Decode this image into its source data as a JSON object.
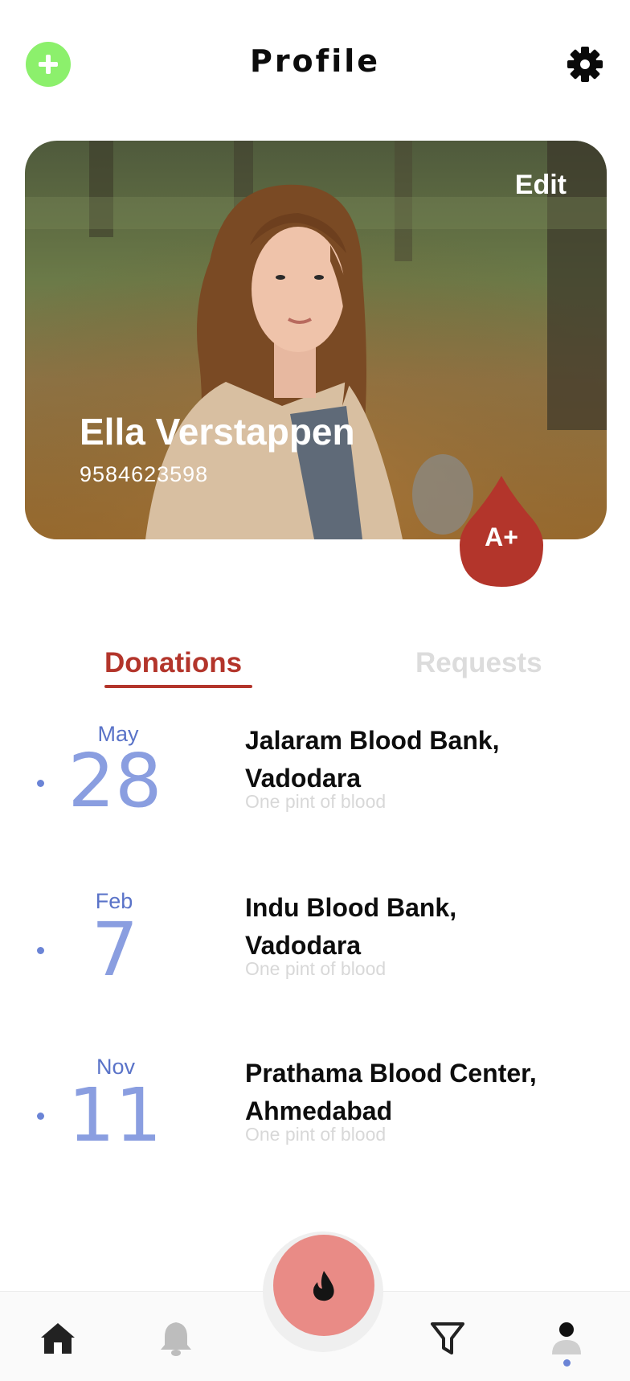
{
  "header": {
    "title": "Profile",
    "add_icon": "plus-circle-icon",
    "settings_icon": "gear-icon",
    "accent": "#8cf06c"
  },
  "profile": {
    "edit_label": "Edit",
    "name": "Ella Verstappen",
    "phone": "9584623598",
    "blood_group": "A+",
    "drop_color": "#b3352b"
  },
  "tabs": {
    "active": "Donations",
    "inactive": "Requests"
  },
  "donations": [
    {
      "month": "May",
      "day": "28",
      "bank_line1": "Jalaram Blood Bank,",
      "bank_line2": "Vadodara",
      "amount": "One pint of blood"
    },
    {
      "month": "Feb",
      "day": "7",
      "bank_line1": "Indu Blood Bank,",
      "bank_line2": "Vadodara",
      "amount": "One pint of blood"
    },
    {
      "month": "Nov",
      "day": "11",
      "bank_line1": "Prathama Blood Center,",
      "bank_line2": "Ahmedabad",
      "amount": "One pint of blood"
    }
  ],
  "nav": {
    "items": [
      "home-icon",
      "bell-icon",
      "flame-icon",
      "filter-icon",
      "user-icon"
    ],
    "active": "user-icon",
    "fab_color": "#e98b86"
  }
}
